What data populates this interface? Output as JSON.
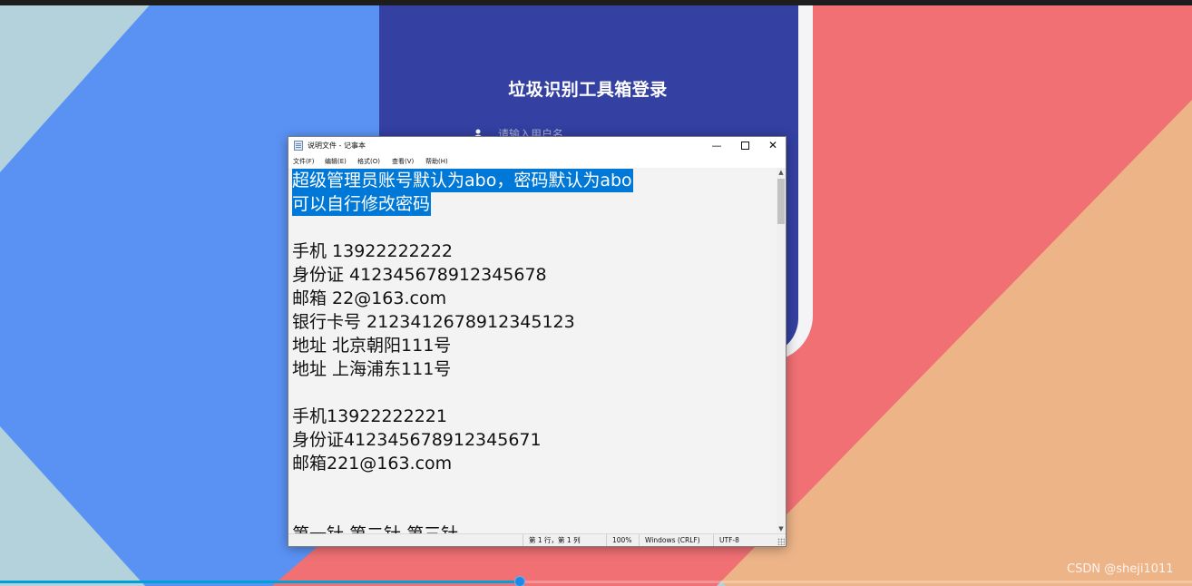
{
  "login": {
    "title": "垃圾识别工具箱登录",
    "username_placeholder": "请输入用户名"
  },
  "notepad": {
    "window_title": "说明文件 - 记事本",
    "controls": {
      "minimize": "—",
      "close": "✕"
    },
    "menu": [
      "文件(F)",
      "编辑(E)",
      "格式(O)",
      "查看(V)",
      "帮助(H)"
    ],
    "lines": [
      "超级管理员账号默认为abo，密码默认为abo",
      "可以自行修改密码",
      "",
      "手机 13922222222",
      "身份证 412345678912345678",
      "邮箱 22@163.com",
      "银行卡号 2123412678912345123",
      "地址 北京朝阳111号",
      "地址 上海浦东111号",
      "",
      "手机13922222221",
      "身份证412345678912345671",
      "邮箱221@163.com",
      "",
      "",
      "第一针 第二针 第三针"
    ],
    "selected_lines": [
      0,
      1
    ],
    "status": {
      "position": "第 1 行，第 1 列",
      "zoom": "100%",
      "line_ending": "Windows (CRLF)",
      "encoding": "UTF-8"
    }
  },
  "player": {
    "progress": 0.436
  },
  "watermark": "CSDN @sheji1011",
  "colors": {
    "login_panel": "#3440a2",
    "selection": "#0078d7",
    "bg_blue": "#5a92f4",
    "bg_coral": "#f07074",
    "bg_peach": "#edb488",
    "bg_lightblue": "#b3d2dc"
  }
}
